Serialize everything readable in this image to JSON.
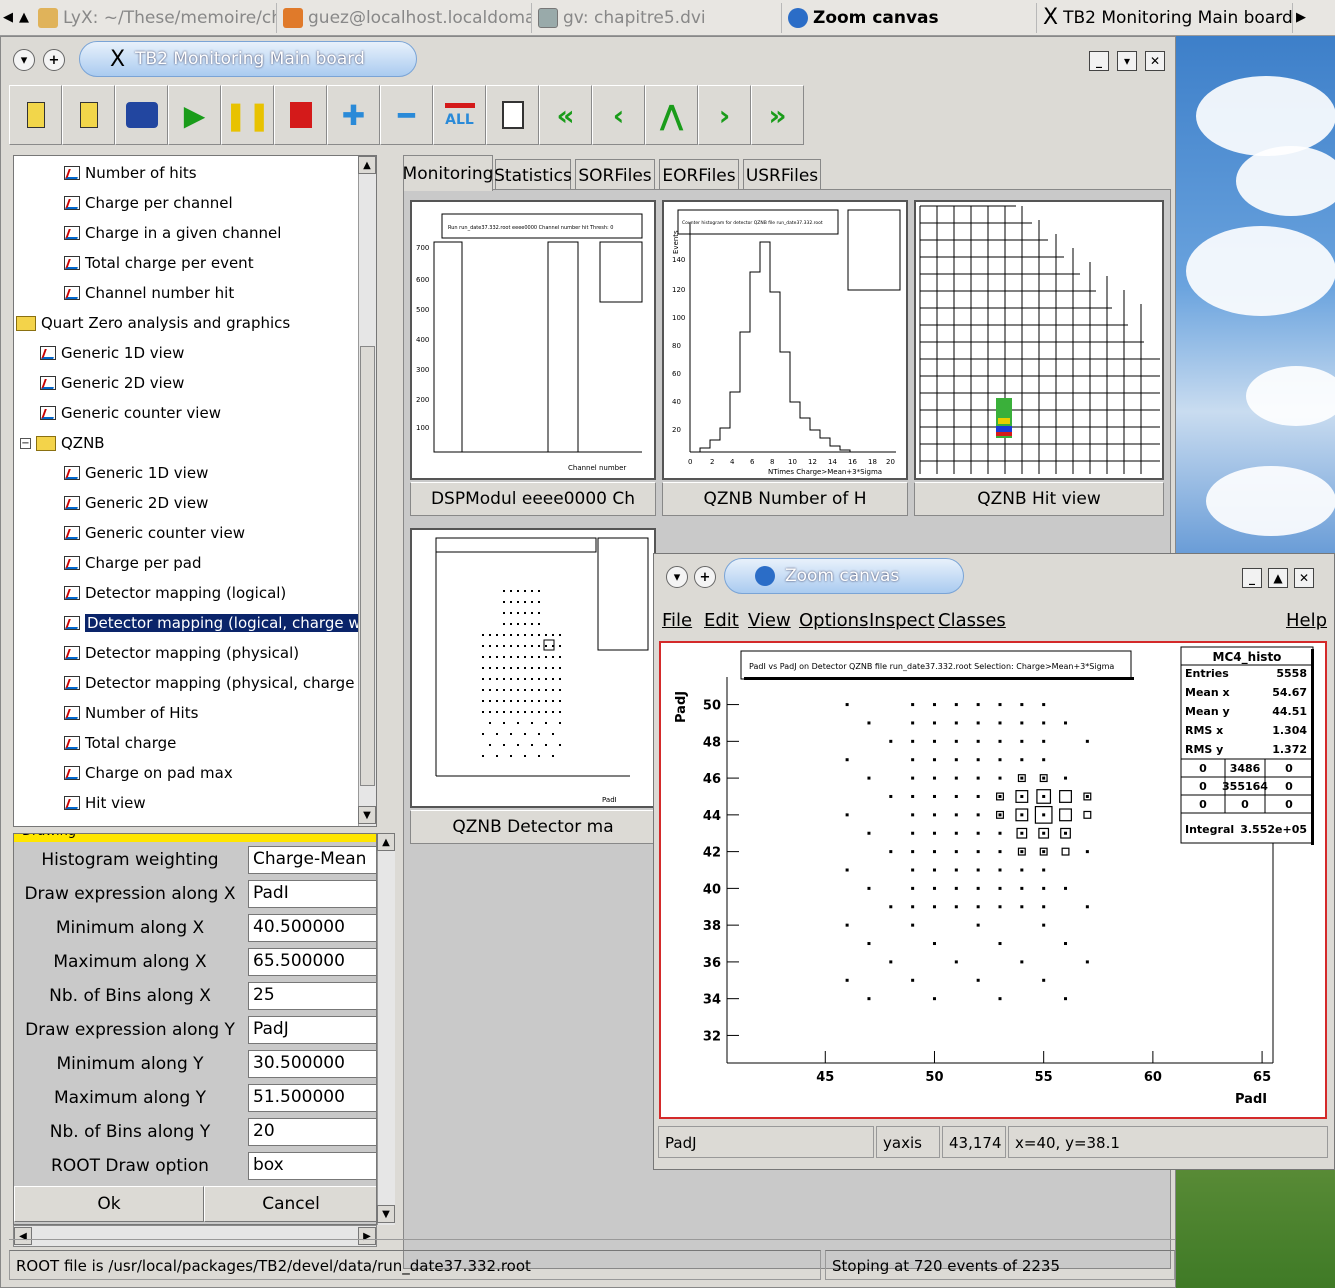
{
  "taskbar": {
    "tasks": [
      {
        "label": "LyX: ~/These/memoire/chapitre"
      },
      {
        "label": "guez@localhost.localdomain: /"
      },
      {
        "label": "gv: chapitre5.dvi"
      },
      {
        "label": "Zoom canvas"
      },
      {
        "label": "TB2 Monitoring Main board"
      }
    ]
  },
  "main": {
    "title": "TB2 Monitoring Main board",
    "toolbar": {
      "all_label": "ALL"
    }
  },
  "tree": {
    "items": [
      {
        "label": "Number of hits"
      },
      {
        "label": "Charge per channel"
      },
      {
        "label": "Charge in a given channel"
      },
      {
        "label": "Total charge per event"
      },
      {
        "label": "Channel number hit"
      },
      {
        "label": "Quart Zero analysis and graphics"
      },
      {
        "label": "Generic 1D view"
      },
      {
        "label": "Generic 2D view"
      },
      {
        "label": "Generic counter view"
      },
      {
        "label": "QZNB"
      },
      {
        "label": "Generic 1D view"
      },
      {
        "label": "Generic 2D view"
      },
      {
        "label": "Generic counter view"
      },
      {
        "label": "Charge per pad"
      },
      {
        "label": "Detector mapping (logical)"
      },
      {
        "label": "Detector mapping (logical, charge weighted)"
      },
      {
        "label": "Detector mapping (physical)"
      },
      {
        "label": "Detector mapping (physical, charge weighted)"
      },
      {
        "label": "Number of Hits"
      },
      {
        "label": "Total charge"
      },
      {
        "label": "Charge on pad max"
      },
      {
        "label": "Hit view"
      }
    ]
  },
  "form": {
    "header": "Drawing",
    "rows": [
      {
        "label": "Histogram weighting",
        "value": "Charge-Mean"
      },
      {
        "label": "Draw expression along X",
        "value": "PadI"
      },
      {
        "label": "Minimum along X",
        "value": "40.500000"
      },
      {
        "label": "Maximum along X",
        "value": "65.500000"
      },
      {
        "label": "Nb. of Bins along X",
        "value": "25"
      },
      {
        "label": "Draw expression along Y",
        "value": "PadJ"
      },
      {
        "label": "Minimum along Y",
        "value": "30.500000"
      },
      {
        "label": "Maximum along Y",
        "value": "51.500000"
      },
      {
        "label": "Nb. of Bins along Y",
        "value": "20"
      },
      {
        "label": "ROOT Draw option",
        "value": "box"
      }
    ],
    "ok": "Ok",
    "cancel": "Cancel"
  },
  "tabs": [
    "Monitoring",
    "Statistics",
    "SORFiles",
    "EORFiles",
    "USRFiles"
  ],
  "pads": [
    {
      "label": "DSPModul eeee0000 Ch",
      "title": "Run run_date37.332.root eeee0000 Channel number hit Thresh: 0",
      "xlabel": "Channel number"
    },
    {
      "label": "QZNB Number of H",
      "title": "Counter histogram for detector QZNB file run_date37.332.root",
      "xlabel": "NTimes Charge>Mean+3*Sigma",
      "ylabel": "Events"
    },
    {
      "label": "QZNB Hit view"
    },
    {
      "label": "QZNB Detector ma",
      "xlabel": "PadI"
    }
  ],
  "zoom": {
    "title": "Zoom canvas",
    "menus": [
      "File",
      "Edit",
      "View",
      "Options",
      "Inspect",
      "Classes",
      "Help"
    ],
    "plot_title": "PadI vs PadJ on Detector QZNB file run_date37.332.root Selection: Charge>Mean+3*Sigma",
    "stats": {
      "name": "MC4_histo",
      "entries_label": "Entries",
      "entries": "5558",
      "meanx_label": "Mean x",
      "meanx": "54.67",
      "meany_label": "Mean y",
      "meany": "44.51",
      "rmsx_label": "RMS x",
      "rmsx": "1.304",
      "rmsy_label": "RMS y",
      "rmsy": "1.372",
      "grid": [
        "0",
        "3486",
        "0",
        "0",
        "355164",
        "0",
        "0",
        "0",
        "0"
      ],
      "integral_label": "Integral",
      "integral": "3.552e+05"
    },
    "status": {
      "object": "PadJ",
      "kind": "yaxis",
      "pixel": "43,174",
      "coords": "x=40, y=38.1"
    }
  },
  "chart_data": {
    "type": "heatmap",
    "title": "PadI vs PadJ on Detector QZNB file run_date37.332.root Selection: Charge>Mean+3*Sigma",
    "xlabel": "PadI",
    "ylabel": "PadJ",
    "xlim": [
      40.5,
      65.5
    ],
    "ylim": [
      30.5,
      51.5
    ],
    "xticks": [
      "45",
      "50",
      "55",
      "60",
      "65"
    ],
    "yticks": [
      "32",
      "34",
      "36",
      "38",
      "40",
      "42",
      "44",
      "46",
      "48",
      "50"
    ],
    "cells": [
      [
        54,
        44,
        3
      ],
      [
        55,
        44,
        6
      ],
      [
        56,
        44,
        3
      ],
      [
        54,
        45,
        3
      ],
      [
        55,
        45,
        4
      ],
      [
        56,
        45,
        3
      ],
      [
        54,
        43,
        2
      ],
      [
        55,
        43,
        2
      ],
      [
        56,
        43,
        2
      ],
      [
        54,
        46,
        1
      ],
      [
        55,
        46,
        1
      ],
      [
        54,
        42,
        1
      ],
      [
        55,
        42,
        1
      ],
      [
        56,
        42,
        1
      ],
      [
        53,
        45,
        1
      ],
      [
        53,
        44,
        1
      ],
      [
        57,
        44,
        1
      ],
      [
        57,
        45,
        1
      ]
    ]
  },
  "status": {
    "left": "ROOT file is /usr/local/packages/TB2/devel/data/run_date37.332.root",
    "right": "Stoping at 720 events of 2235"
  }
}
